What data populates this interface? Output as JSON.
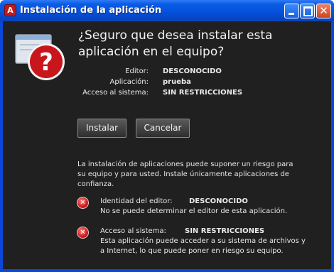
{
  "window": {
    "title": "Instalación de la aplicación",
    "app_icon_glyph": "A"
  },
  "heading": "¿Seguro que desea instalar esta aplicación en el equipo?",
  "details": {
    "publisher_label": "Editor:",
    "publisher_value": "DESCONOCIDO",
    "application_label": "Aplicación:",
    "application_value": "prueba",
    "access_label": "Acceso al sistema:",
    "access_value": "SIN RESTRICCIONES"
  },
  "buttons": {
    "install": "Instalar",
    "cancel": "Cancelar"
  },
  "warning": {
    "line1": "La instalación de aplicaciones puede suponer un riesgo para",
    "line2": "su equipo y para usted. Instale únicamente aplicaciones de",
    "line3": "confianza."
  },
  "risks": [
    {
      "label": "Identidad del editor:",
      "value": "DESCONOCIDO",
      "desc1": "No se puede determinar el editor de esta aplicación."
    },
    {
      "label": "Acceso al sistema:",
      "value": "SIN RESTRICCIONES",
      "desc1": "Esta aplicación puede acceder a su sistema de archivos y",
      "desc2": "a Internet, lo que puede poner en riesgo su equipo."
    }
  ],
  "icons": {
    "caption_close_glyph": "✕",
    "error_glyph": "✕",
    "big_question_glyph": "?"
  },
  "colors": {
    "background": "#202020",
    "titlebar": "#0552dc",
    "error_red": "#c41010"
  }
}
